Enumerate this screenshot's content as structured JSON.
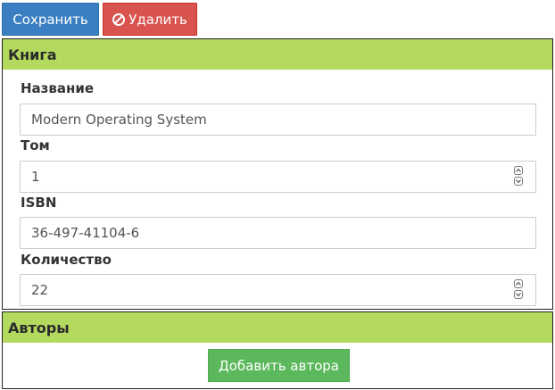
{
  "toolbar": {
    "save_label": "Сохранить",
    "delete_label": "Удалить"
  },
  "book_panel": {
    "title": "Книга",
    "fields": {
      "title_label": "Название",
      "title_value": "Modern Operating System",
      "volume_label": "Том",
      "volume_value": "1",
      "isbn_label": "ISBN",
      "isbn_value": "36-497-41104-6",
      "quantity_label": "Количество",
      "quantity_value": "22"
    }
  },
  "authors_panel": {
    "title": "Авторы",
    "add_author_label": "Добавить автора"
  },
  "colors": {
    "primary": "#3a7fc1",
    "danger": "#d9534f",
    "success": "#5cb85c",
    "panel_heading": "#b3d95f"
  }
}
